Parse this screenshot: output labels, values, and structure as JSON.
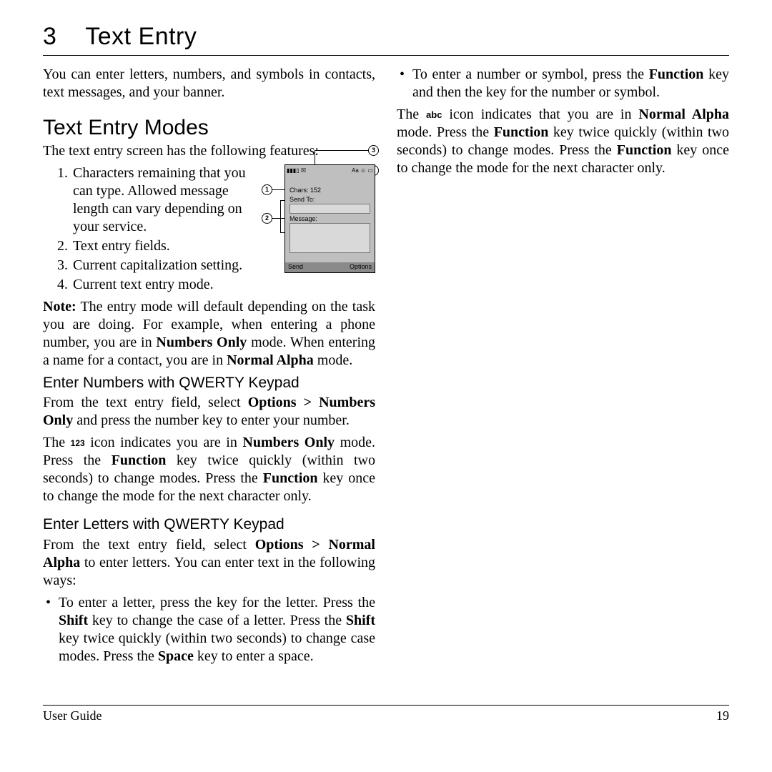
{
  "chapter": {
    "number": "3",
    "title": "Text Entry"
  },
  "intro": "You can enter letters, numbers, and symbols in contacts, text messages, and your banner.",
  "section1": {
    "title": "Text Entry Modes",
    "lead": "The text entry screen has the following features:",
    "list": [
      "Characters remaining that you can type. Allowed message length can vary depending on your service.",
      "Text entry fields.",
      "Current capitalization setting.",
      "Current text entry mode."
    ],
    "note_label": "Note:",
    "note": " The entry mode will default depending on the task you are doing. For example, when entering a phone number, you are in ",
    "note_b1": "Numbers Only",
    "note_mid": " mode. When entering a name for a contact, you are in ",
    "note_b2": "Normal Alpha",
    "note_end": " mode."
  },
  "figure": {
    "status_left": "▮▮▮▯ ☒",
    "status_right": "Aa ☺ ▭",
    "chars_label": "Chars: 152",
    "sendto_label": "Send To:",
    "message_label": "Message:",
    "soft_left": "Send",
    "soft_right": "Options",
    "callouts": {
      "1": "1",
      "2": "2",
      "3": "3",
      "4": "4"
    }
  },
  "sub1": {
    "title": "Enter Numbers with QWERTY Keypad",
    "p1a": "From the text entry field, select ",
    "p1b": "Options > Numbers Only",
    "p1c": " and press the number key to enter your number.",
    "p2a": "The ",
    "icon123": "123",
    "p2b": " icon indicates you are in ",
    "p2c": "Numbers Only",
    "p2d": " mode. Press the ",
    "fn": "Function",
    "p2e": " key twice quickly (within two seconds) to change modes. Press the ",
    "p2f": " key once to change the mode for the next character only."
  },
  "sub2": {
    "title": "Enter Letters with QWERTY Keypad",
    "p1a": "From the text entry field, select ",
    "p1b": "Options > Normal Alpha",
    "p1c": " to enter letters. You can enter text in the following ways:",
    "li1a": "To enter a letter, press the key for the letter. Press the ",
    "shift": "Shift",
    "li1b": " key to change the case of a letter. Press the ",
    "li1c": " key twice quickly (within two seconds) to change case modes. Press the ",
    "space": "Space",
    "li1d": " key to enter a space.",
    "li2a": "To enter a number or symbol, press the ",
    "li2b": " key and then the key for the number or symbol.",
    "p2a": "The ",
    "iconabc": "abc",
    "p2b": " icon indicates that you are in ",
    "p2c": "Normal Alpha",
    "p2d": " mode. Press the ",
    "p2e": " key twice quickly (within two seconds) to change modes. Press the ",
    "p2f": " key once to change the mode for the next character only."
  },
  "footer": {
    "left": "User Guide",
    "right": "19"
  }
}
